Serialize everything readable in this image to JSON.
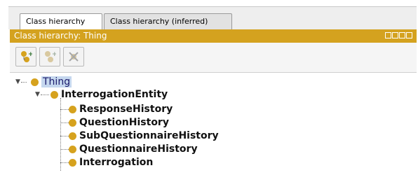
{
  "tabs": [
    {
      "label": "Class hierarchy",
      "active": true
    },
    {
      "label": "Class hierarchy (inferred)",
      "active": false
    }
  ],
  "panel": {
    "title": "Class hierarchy: Thing",
    "header_color": "#d4a21f"
  },
  "toolbar": {
    "buttons": [
      {
        "name": "add-subclass-icon",
        "enabled": true
      },
      {
        "name": "add-sibling-icon",
        "enabled": false
      },
      {
        "name": "delete-class-icon",
        "enabled": false
      }
    ]
  },
  "tree": {
    "root": "Thing",
    "level1": "InterrogationEntity",
    "children": [
      "ResponseHistory",
      "QuestionHistory",
      "SubQuestionnaireHistory",
      "QuestionnaireHistory",
      "Interrogation"
    ]
  }
}
